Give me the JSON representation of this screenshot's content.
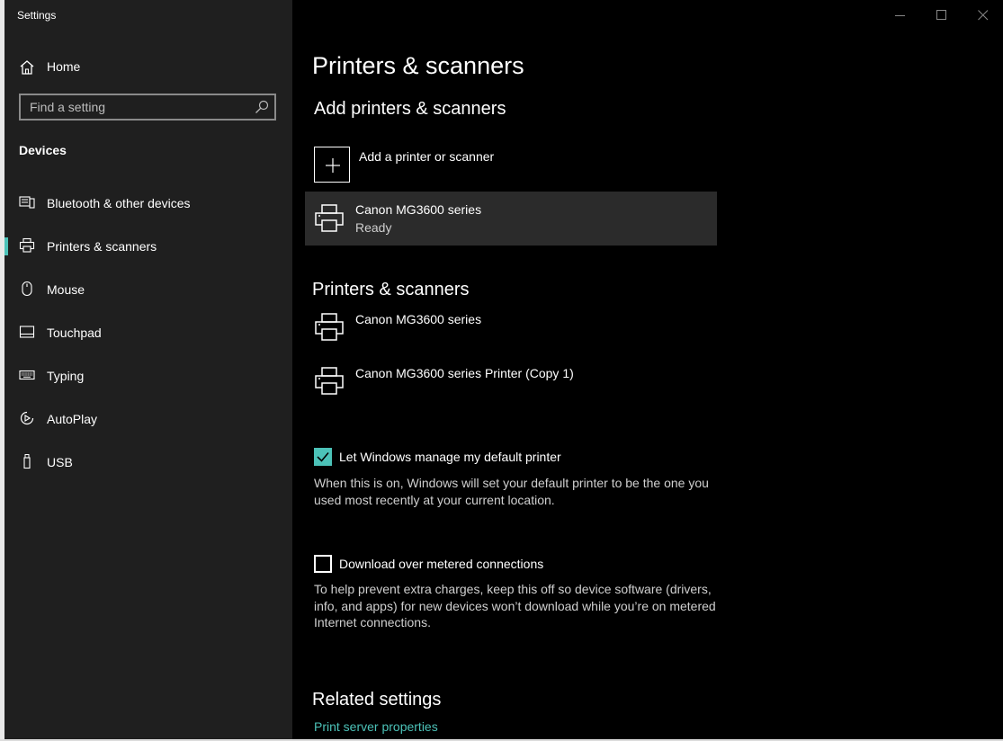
{
  "window": {
    "title": "Settings"
  },
  "sidebar": {
    "home_label": "Home",
    "search_placeholder": "Find a setting",
    "section_title": "Devices",
    "items": [
      {
        "label": "Bluetooth & other devices",
        "icon": "bluetooth-devices-icon"
      },
      {
        "label": "Printers & scanners",
        "icon": "printer-icon",
        "active": true
      },
      {
        "label": "Mouse",
        "icon": "mouse-icon"
      },
      {
        "label": "Touchpad",
        "icon": "touchpad-icon"
      },
      {
        "label": "Typing",
        "icon": "keyboard-icon"
      },
      {
        "label": "AutoPlay",
        "icon": "autoplay-icon"
      },
      {
        "label": "USB",
        "icon": "usb-icon"
      }
    ]
  },
  "main": {
    "title": "Printers & scanners",
    "add_section_title": "Add printers & scanners",
    "add_label": "Add a printer or scanner",
    "found_printer": {
      "name": "Canon MG3600 series",
      "status": "Ready"
    },
    "list_title": "Printers & scanners",
    "printers": [
      {
        "name": "Canon MG3600 series"
      },
      {
        "name": "Canon MG3600 series Printer (Copy 1)"
      }
    ],
    "default_printer": {
      "label": "Let Windows manage my default printer",
      "checked": true,
      "description": "When this is on, Windows will set your default printer to be the one you used most recently at your current location."
    },
    "metered": {
      "label": "Download over metered connections",
      "checked": false,
      "description": "To help prevent extra charges, keep this off so device software (drivers, info, and apps) for new devices won’t download while you’re on metered Internet connections."
    },
    "related_title": "Related settings",
    "related_link": "Print server properties"
  },
  "colors": {
    "accent": "#4cc2b8",
    "sidebar_bg": "#1f1f1f",
    "main_bg": "#000000",
    "selected_bg": "#2b2b2b"
  }
}
